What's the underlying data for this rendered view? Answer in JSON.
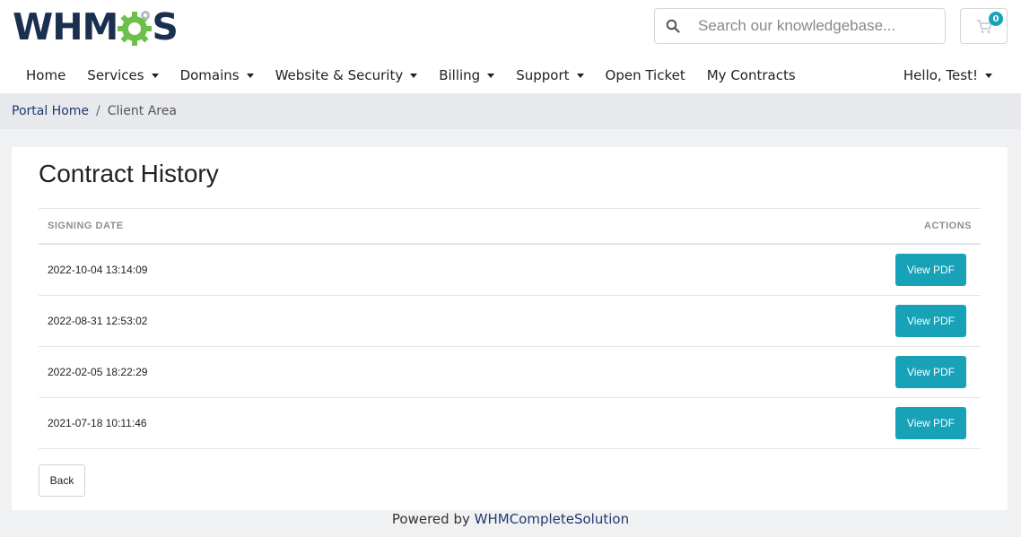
{
  "header": {
    "logo_text": "WHM",
    "logo_suffix": "S",
    "search_placeholder": "Search our knowledgebase...",
    "cart_count": "0"
  },
  "nav": {
    "items": [
      {
        "label": "Home",
        "dropdown": false
      },
      {
        "label": "Services",
        "dropdown": true
      },
      {
        "label": "Domains",
        "dropdown": true
      },
      {
        "label": "Website & Security",
        "dropdown": true
      },
      {
        "label": "Billing",
        "dropdown": true
      },
      {
        "label": "Support",
        "dropdown": true
      },
      {
        "label": "Open Ticket",
        "dropdown": false
      },
      {
        "label": "My Contracts",
        "dropdown": false
      }
    ],
    "user_greeting": "Hello, Test!"
  },
  "breadcrumb": {
    "home": "Portal Home",
    "separator": "/",
    "current": "Client Area"
  },
  "main": {
    "title": "Contract History",
    "table": {
      "headers": [
        "SIGNING DATE",
        "ACTIONS"
      ],
      "rows": [
        {
          "signing_date": "2022-10-04 13:14:09",
          "action": "View PDF"
        },
        {
          "signing_date": "2022-08-31 12:53:02",
          "action": "View PDF"
        },
        {
          "signing_date": "2022-02-05 18:22:29",
          "action": "View PDF"
        },
        {
          "signing_date": "2021-07-18 10:11:46",
          "action": "View PDF"
        }
      ]
    },
    "back_label": "Back"
  },
  "footer": {
    "prefix": "Powered by",
    "link": "WHMCompleteSolution"
  },
  "colors": {
    "brand_navy": "#1b3050",
    "brand_green": "#6cc04a",
    "accent_teal": "#17a2b8"
  }
}
